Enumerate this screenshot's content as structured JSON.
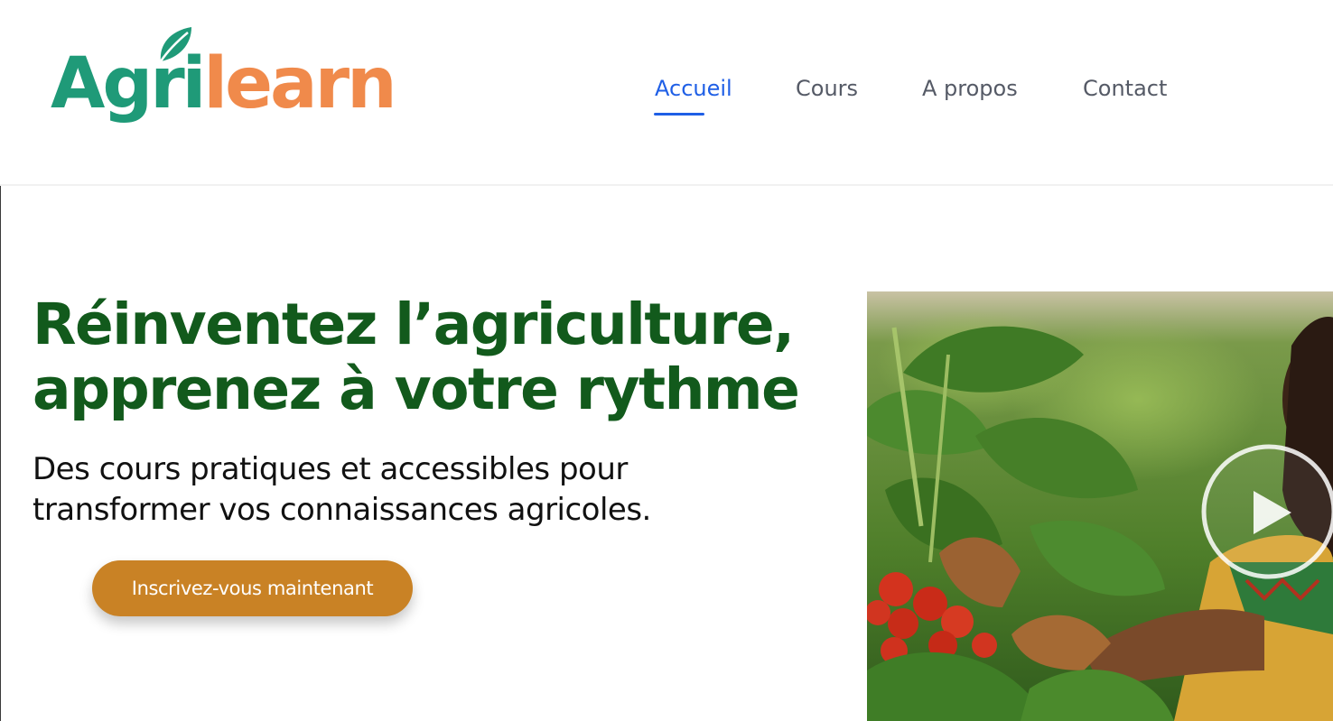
{
  "brand": {
    "part1": "Agri",
    "part2": "learn",
    "colors": {
      "green": "#1f9a78",
      "orange": "#f08a4b"
    }
  },
  "nav": {
    "items": [
      {
        "label": "Accueil",
        "active": true
      },
      {
        "label": "Cours",
        "active": false
      },
      {
        "label": "A propos",
        "active": false
      },
      {
        "label": "Contact",
        "active": false
      }
    ],
    "active_color": "#1f5fe6"
  },
  "hero": {
    "title_line1": "Réinventez l’agriculture,",
    "title_line2": "apprenez à votre rythme",
    "subtitle_line1": "Des cours pratiques et accessibles pour",
    "subtitle_line2": "transformer vos connaissances agricoles.",
    "cta_label": "Inscrivez-vous maintenant",
    "cta_color": "#c98225",
    "title_color": "#125a1c"
  },
  "media": {
    "play_icon": "play-icon"
  }
}
